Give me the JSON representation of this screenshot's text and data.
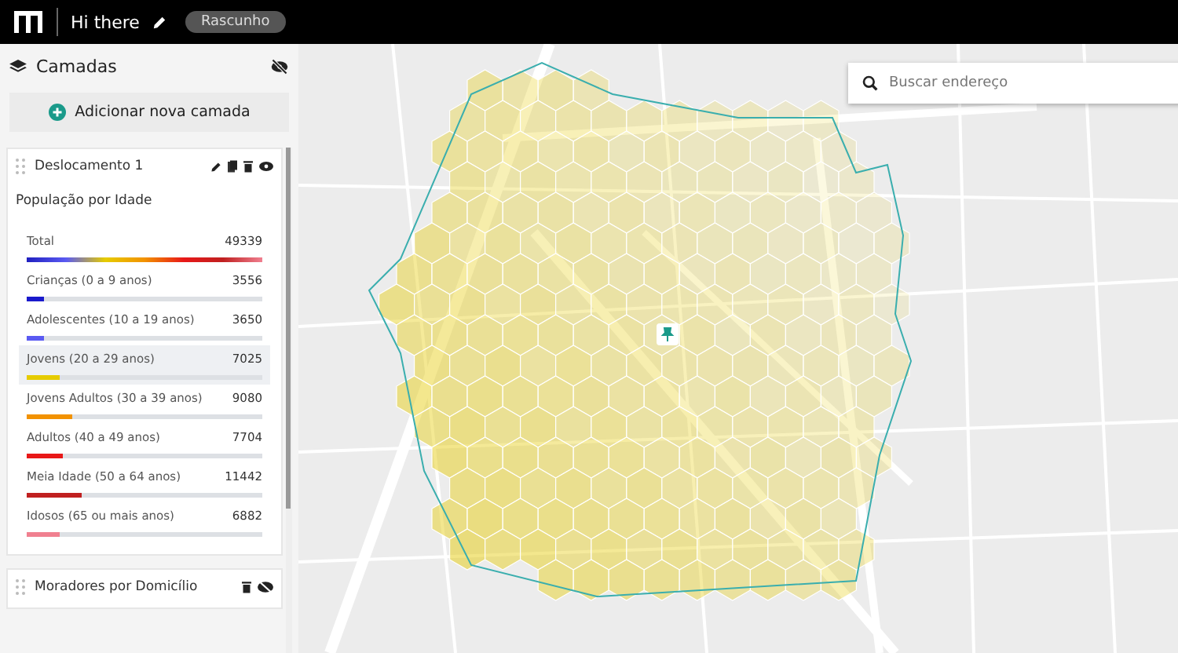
{
  "header": {
    "title": "Hi there",
    "status_badge": "Rascunho"
  },
  "sidebar": {
    "title": "Camadas",
    "add_button": "Adicionar nova camada",
    "layers": [
      {
        "name": "Deslocamento 1",
        "expanded": true,
        "subtitle": "População por Idade",
        "rows": [
          {
            "kind": "gradient",
            "label": "Total",
            "value": "49339",
            "level": 1.0,
            "highlighted": false
          },
          {
            "kind": "solid",
            "label": "Crianças (0 a 9 anos)",
            "value": "3556",
            "level": 0.07,
            "color": "#1a1acc",
            "highlighted": false
          },
          {
            "kind": "solid",
            "label": "Adolescentes (10 a 19 anos)",
            "value": "3650",
            "level": 0.07,
            "color": "#5a5af2",
            "highlighted": false
          },
          {
            "kind": "solid",
            "label": "Jovens (20 a 29 anos)",
            "value": "7025",
            "level": 0.14,
            "color": "#e6cc00",
            "highlighted": true
          },
          {
            "kind": "solid",
            "label": "Jovens Adultos (30 a 39 anos)",
            "value": "9080",
            "level": 0.19,
            "color": "#f29200",
            "highlighted": false
          },
          {
            "kind": "solid",
            "label": "Adultos (40 a 49 anos)",
            "value": "7704",
            "level": 0.15,
            "color": "#e81818",
            "highlighted": false
          },
          {
            "kind": "solid",
            "label": "Meia Idade (50 a 64 anos)",
            "value": "11442",
            "level": 0.23,
            "color": "#c02020",
            "highlighted": false
          },
          {
            "kind": "solid",
            "label": "Idosos (65 ou mais anos)",
            "value": "6882",
            "level": 0.14,
            "color": "#f08090",
            "highlighted": false
          }
        ]
      },
      {
        "name": "Moradores por Domicílio",
        "expanded": false
      }
    ]
  },
  "map": {
    "search": {
      "placeholder": "Buscar endereço"
    }
  }
}
